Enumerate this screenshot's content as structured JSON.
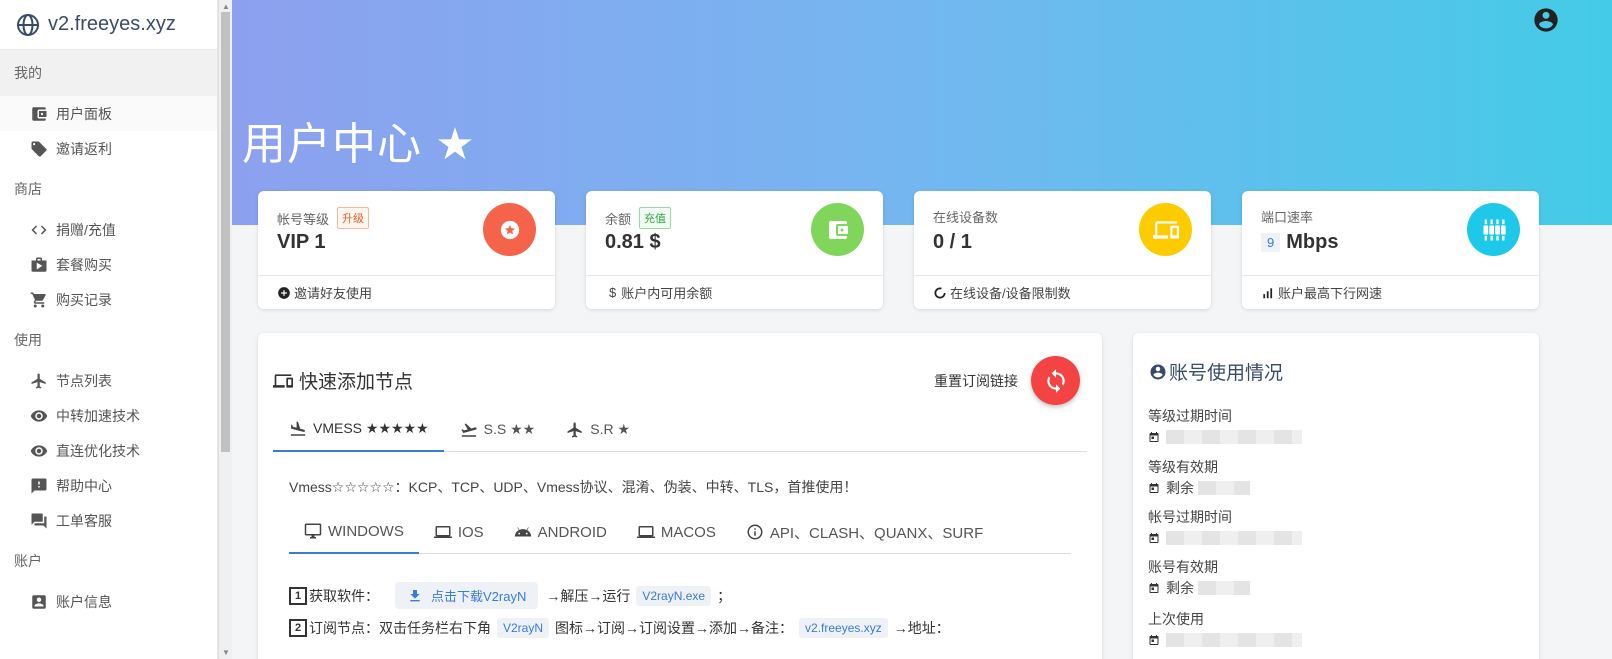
{
  "brand": {
    "title": "v2.freeyes.xyz"
  },
  "sidebar": {
    "sections": [
      {
        "label": "我的",
        "items": [
          "用户面板",
          "邀请返利"
        ]
      },
      {
        "label": "商店",
        "items": [
          "捐赠/充值",
          "套餐购买",
          "购买记录"
        ]
      },
      {
        "label": "使用",
        "items": [
          "节点列表",
          "中转加速技术",
          "直连优化技术",
          "帮助中心",
          "工单客服"
        ]
      },
      {
        "label": "账户",
        "items": [
          "账户信息"
        ]
      }
    ]
  },
  "header": {
    "title": "用户中心 ★"
  },
  "stats": [
    {
      "label": "帐号等级",
      "badge": "升级",
      "value": "VIP 1",
      "footer": "邀请好友使用",
      "color": "#f5634a"
    },
    {
      "label": "余额",
      "badge": "充值",
      "value": "0.81 $",
      "footer": "账户内可用余额",
      "color": "#7fd65a"
    },
    {
      "label": "在线设备数",
      "value": "0 / 1",
      "footer": "在线设备/设备限制数",
      "color": "#fccb00"
    },
    {
      "label": "端口速率",
      "value_num": "9",
      "value_unit": "Mbps",
      "footer": "账户最高下行网速",
      "color": "#1ec8e8"
    }
  ],
  "quick": {
    "title": "快速添加节点",
    "reset_label": "重置订阅链接",
    "protocol_tabs": [
      "VMESS ★★★★★",
      "S.S ★★",
      "S.R ★"
    ],
    "description": "Vmess☆☆☆☆☆：KCP、TCP、UDP、Vmess协议、混淆、伪装、中转、TLS，首推使用！",
    "platform_tabs": [
      "WINDOWS",
      "IOS",
      "ANDROID",
      "MACOS",
      "API、CLASH、QUANX、SURF"
    ],
    "step1": {
      "num": "1",
      "label": "获取软件：",
      "download": "点击下载V2rayN",
      "mid": "→解压→运行",
      "exe": "V2rayN.exe",
      "end": "；"
    },
    "step2": {
      "num": "2",
      "label": "订阅节点：双击任务栏右下角",
      "chip1": "V2rayN",
      "mid": "图标→订阅→订阅设置→添加→备注：",
      "chip2": "v2.freeyes.xyz",
      "end": "→地址："
    }
  },
  "usage": {
    "title": "账号使用情况",
    "rows": [
      {
        "label": "等级过期时间",
        "prefix": ""
      },
      {
        "label": "等级有效期",
        "prefix": "剩余"
      },
      {
        "label": "帐号过期时间",
        "prefix": ""
      },
      {
        "label": "账号有效期",
        "prefix": "剩余"
      },
      {
        "label": "上次使用",
        "prefix": ""
      }
    ]
  }
}
